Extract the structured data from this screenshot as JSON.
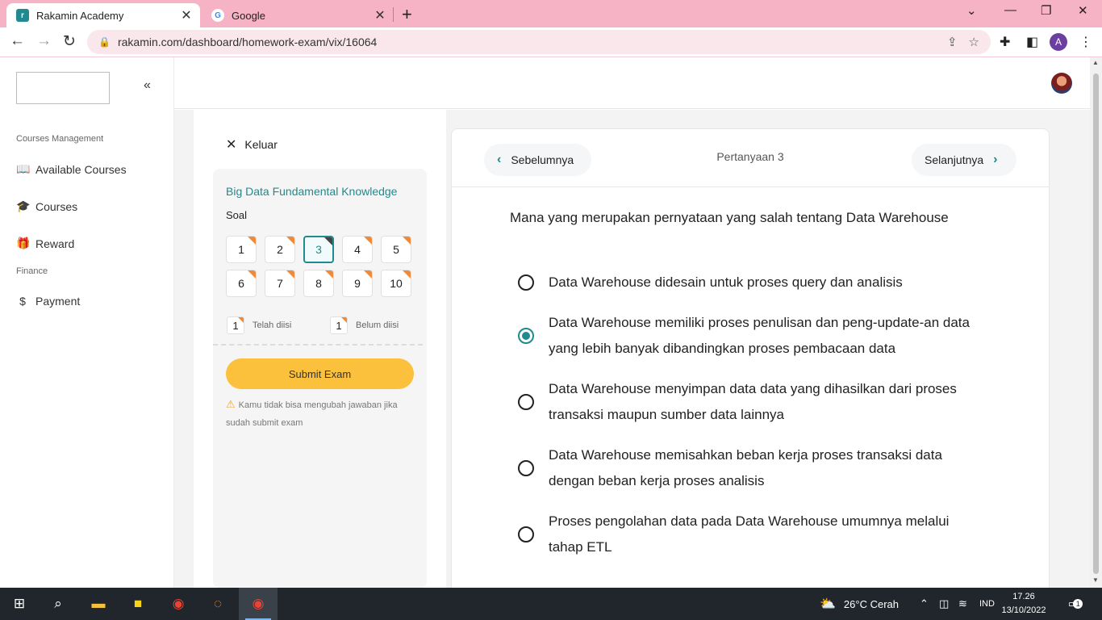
{
  "browser": {
    "tabs": [
      {
        "title": "Rakamin Academy",
        "active": true,
        "favicon_letter": "r"
      },
      {
        "title": "Google",
        "active": false,
        "favicon_letter": "G"
      }
    ],
    "url": "rakamin.com/dashboard/homework-exam/vix/16064",
    "profile_initial": "A"
  },
  "sidebar": {
    "sections": [
      {
        "heading": "Courses Management",
        "items": [
          {
            "label": "Available Courses",
            "icon": "book-open-icon"
          },
          {
            "label": "Courses",
            "icon": "graduation-cap-icon"
          },
          {
            "label": "Reward",
            "icon": "gift-icon"
          }
        ]
      },
      {
        "heading": "Finance",
        "items": [
          {
            "label": "Payment",
            "icon": "dollar-icon"
          }
        ]
      }
    ]
  },
  "exam": {
    "exit_label": "Keluar",
    "course_title": "Big Data Fundamental Knowledge",
    "soal_label": "Soal",
    "questions": [
      "1",
      "2",
      "3",
      "4",
      "5",
      "6",
      "7",
      "8",
      "9",
      "10"
    ],
    "current_question": "3",
    "legend": {
      "answered_count": "1",
      "answered_label": "Telah diisi",
      "unanswered_count": "1",
      "unanswered_label": "Belum diisi"
    },
    "submit_label": "Submit Exam",
    "warning": "Kamu tidak bisa mengubah jawaban jika sudah submit exam"
  },
  "question_card": {
    "prev_label": "Sebelumnya",
    "next_label": "Selanjutnya",
    "question_number_label": "Pertanyaan 3",
    "question_text": "Mana yang merupakan pernyataan yang salah tentang Data Warehouse",
    "options": [
      {
        "text": "Data Warehouse didesain untuk proses query dan analisis",
        "selected": false
      },
      {
        "text": "Data Warehouse memiliki proses penulisan dan peng-update-an data yang lebih banyak dibandingkan proses pembacaan data",
        "selected": true
      },
      {
        "text": "Data Warehouse menyimpan data data yang dihasilkan dari proses transaksi maupun sumber data lainnya",
        "selected": false
      },
      {
        "text": "Data Warehouse memisahkan beban kerja proses transaksi data dengan beban kerja proses analisis",
        "selected": false
      },
      {
        "text": "Proses pengolahan data pada Data Warehouse umumnya melalui tahap ETL",
        "selected": false
      }
    ]
  },
  "taskbar": {
    "weather": "26°C  Cerah",
    "language": "IND",
    "time": "17.26",
    "date": "13/10/2022",
    "notification_count": "1"
  },
  "colors": {
    "accent": "#1f8a8f",
    "submit": "#fbc13c",
    "badge_corner": "#f08a3b",
    "browser_frame": "#f6b3c6"
  }
}
